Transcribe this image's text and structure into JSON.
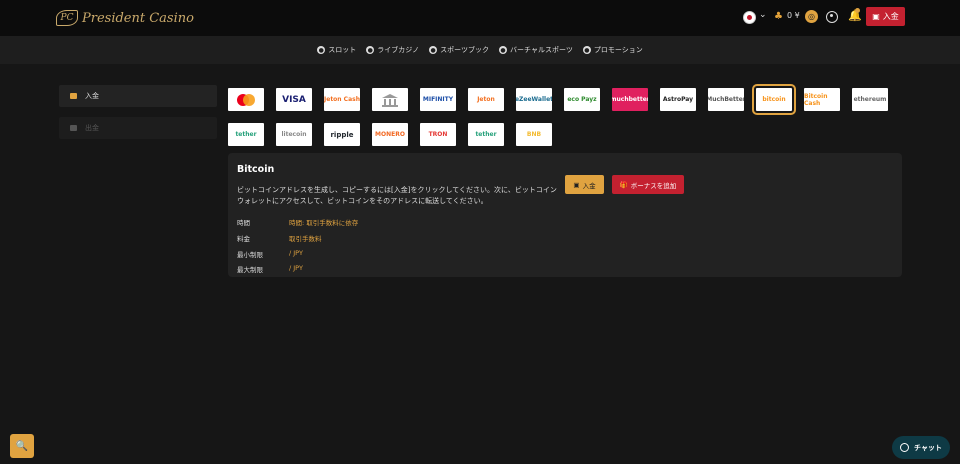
{
  "header": {
    "brand": "President Casino",
    "balance": "0 ¥",
    "deposit_label": "入金"
  },
  "nav": [
    {
      "label": "スロット",
      "icon": "slot-icon"
    },
    {
      "label": "ライブカジノ",
      "icon": "live-casino-icon"
    },
    {
      "label": "スポーツブック",
      "icon": "sportsbook-icon"
    },
    {
      "label": "バーチャルスポーツ",
      "icon": "virtual-sports-icon"
    },
    {
      "label": "プロモーション",
      "icon": "promotion-icon"
    }
  ],
  "sidebar": {
    "items": [
      {
        "label": "入金",
        "active": true
      },
      {
        "label": "出金",
        "active": false
      }
    ]
  },
  "methods": [
    {
      "label": "",
      "name": "mastercard"
    },
    {
      "label": "VISA",
      "name": "visa"
    },
    {
      "label": "Jeton Cash",
      "name": "jeton-cash"
    },
    {
      "label": "",
      "name": "bank-transfer"
    },
    {
      "label": "MIFINITY",
      "name": "mifinity"
    },
    {
      "label": "Jeton",
      "name": "jeton"
    },
    {
      "label": "eZeeWallet",
      "name": "ezeewallet"
    },
    {
      "label": "eco Payz",
      "name": "ecopayz"
    },
    {
      "label": "muchbetter",
      "name": "muchbetter-red"
    },
    {
      "label": "AstroPay",
      "name": "astropay"
    },
    {
      "label": "MuchBetter",
      "name": "muchbetter"
    },
    {
      "label": "bitcoin",
      "name": "bitcoin"
    },
    {
      "label": "Bitcoin Cash",
      "name": "bitcoin-cash"
    },
    {
      "label": "ethereum",
      "name": "ethereum"
    },
    {
      "label": "tether",
      "name": "tether"
    },
    {
      "label": "litecoin",
      "name": "litecoin"
    },
    {
      "label": "ripple",
      "name": "ripple"
    },
    {
      "label": "MONERO",
      "name": "monero"
    },
    {
      "label": "TRON",
      "name": "tron"
    },
    {
      "label": "tether",
      "name": "tether-tron"
    },
    {
      "label": "BNB",
      "name": "bnb"
    }
  ],
  "detail": {
    "title": "Bitcoin",
    "description": "ビットコインアドレスを生成し、コピーするには[入金]をクリックしてください。次に、ビットコインウォレットにアクセスして、ビットコインをそのアドレスに転送してください。",
    "deposit_label": "入金",
    "bonus_label": "ボーナスを追加",
    "rows": [
      {
        "label": "時間",
        "value": "時間: 取引手数料に依存"
      },
      {
        "label": "料金",
        "value": "取引手数料"
      },
      {
        "label": "最小制限",
        "value": " / JPY"
      },
      {
        "label": "最大制限",
        "value": " / JPY"
      }
    ]
  },
  "chat": {
    "label": "チャット"
  },
  "colors": {
    "accent": "#e0a340",
    "brand_red": "#c42130",
    "background": "#161616"
  }
}
